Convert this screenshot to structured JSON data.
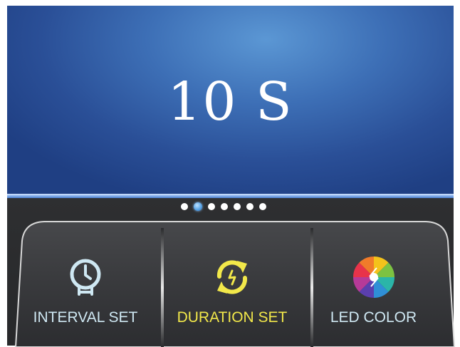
{
  "display": {
    "value": "10 S"
  },
  "pager": {
    "count": 7,
    "active_index": 1
  },
  "buttons": {
    "interval": {
      "label": "INTERVAL SET",
      "icon": "clock-icon",
      "color": "#cfe8f3"
    },
    "duration": {
      "label": "DURATION SET",
      "icon": "refresh-icon",
      "color": "#f2e84a"
    },
    "led": {
      "label": "LED COLOR",
      "icon": "color-wheel-icon"
    }
  },
  "colors": {
    "screen": "#3d6fb6",
    "accent": "#f2e84a",
    "panel": "#2a2b2d"
  }
}
